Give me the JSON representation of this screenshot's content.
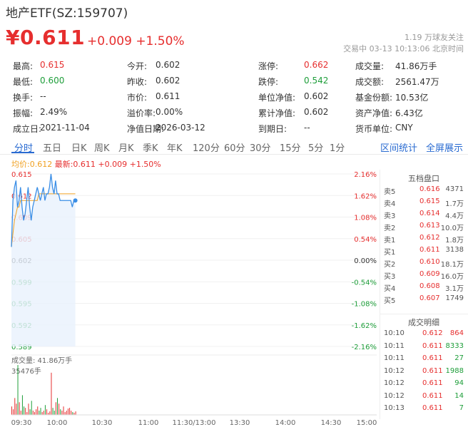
{
  "header": {
    "title": "地产ETF(SZ:159707)",
    "price": "¥0.611",
    "change": "+0.009  +1.50%",
    "followers": "1.19 万球友关注",
    "status": "交易中  03-13 10:13:06 北京时间"
  },
  "quote": [
    [
      {
        "l": "最高:",
        "v": "0.615",
        "c": "up"
      },
      {
        "l": "今开:",
        "v": "0.602",
        "c": ""
      },
      {
        "l": "涨停:",
        "v": "0.662",
        "c": "up"
      },
      {
        "l": "成交量:",
        "v": "41.86万手",
        "c": ""
      }
    ],
    [
      {
        "l": "最低:",
        "v": "0.600",
        "c": "down"
      },
      {
        "l": "昨收:",
        "v": "0.602",
        "c": ""
      },
      {
        "l": "跌停:",
        "v": "0.542",
        "c": "down"
      },
      {
        "l": "成交额:",
        "v": "2561.47万",
        "c": ""
      }
    ],
    [
      {
        "l": "换手:",
        "v": "--",
        "c": ""
      },
      {
        "l": "市价:",
        "v": "0.611",
        "c": ""
      },
      {
        "l": "单位净值:",
        "v": "0.602",
        "c": ""
      },
      {
        "l": "基金份额:",
        "v": "10.53亿",
        "c": ""
      }
    ],
    [
      {
        "l": "振幅:",
        "v": "2.49%",
        "c": ""
      },
      {
        "l": "溢价率:",
        "v": "0.00%",
        "c": ""
      },
      {
        "l": "累计净值:",
        "v": "0.602",
        "c": ""
      },
      {
        "l": "资产净值:",
        "v": "6.43亿",
        "c": ""
      }
    ],
    [
      {
        "l": "成立日:",
        "v": "2021-11-04",
        "c": ""
      },
      {
        "l": "净值日期:",
        "v": "2026-03-12",
        "c": ""
      },
      {
        "l": "到期日:",
        "v": "--",
        "c": ""
      },
      {
        "l": "货币单位:",
        "v": "CNY",
        "c": ""
      }
    ]
  ],
  "tabs": [
    "分时",
    "五日",
    "日K",
    "周K",
    "月K",
    "季K",
    "年K",
    "120分",
    "60分",
    "30分",
    "15分",
    "5分",
    "1分"
  ],
  "links": {
    "interval_stats": "区间统计",
    "fullscreen": "全屏展示"
  },
  "legend": {
    "avg": "均价:0.612",
    "last": "最新:0.611 +0.009 +1.50%"
  },
  "chart_data": {
    "type": "line",
    "y_left": [
      "0.615",
      "0.612",
      "0.609",
      "0.605",
      "0.602",
      "0.599",
      "0.595",
      "0.592",
      "0.589"
    ],
    "y_right": [
      "2.16%",
      "1.62%",
      "1.08%",
      "0.54%",
      "0.00%",
      "-0.54%",
      "-1.08%",
      "-1.62%",
      "-2.16%"
    ],
    "ylim": [
      0.589,
      0.615
    ],
    "x_ticks": [
      "09:30",
      "10:00",
      "10:30",
      "11:00",
      "11:30/13:00",
      "13:30",
      "14:00",
      "14:30",
      "15:00"
    ],
    "price": [
      0.604,
      0.611,
      0.613,
      0.614,
      0.61,
      0.611,
      0.613,
      0.61,
      0.608,
      0.609,
      0.611,
      0.613,
      0.61,
      0.608,
      0.61,
      0.611,
      0.612,
      0.613,
      0.612,
      0.611,
      0.612,
      0.613,
      0.611,
      0.612,
      0.612,
      0.613,
      0.615,
      0.613,
      0.612,
      0.614,
      0.612,
      0.612,
      0.611,
      0.611,
      0.611,
      0.611,
      0.611,
      0.611,
      0.611,
      0.611,
      0.61,
      0.611,
      0.611
    ],
    "avg": [
      0.604,
      0.606,
      0.608,
      0.609,
      0.61,
      0.61,
      0.611,
      0.611,
      0.611,
      0.611,
      0.611,
      0.611,
      0.611,
      0.611,
      0.611,
      0.611,
      0.611,
      0.611,
      0.612,
      0.612,
      0.612,
      0.612,
      0.612,
      0.612,
      0.612,
      0.612,
      0.612,
      0.612,
      0.612,
      0.612,
      0.612,
      0.612,
      0.612,
      0.612,
      0.612,
      0.612,
      0.612,
      0.612,
      0.612,
      0.612,
      0.612,
      0.612,
      0.612
    ],
    "volume_label": "成交量: 41.86万手",
    "volume_max_label": "35476手",
    "volume_max": 35476,
    "volume": [
      6000,
      4000,
      12000,
      8000,
      35476,
      9000,
      3000,
      14000,
      6000,
      5000,
      2000,
      8000,
      4000,
      10000,
      3000,
      2000,
      4000,
      6000,
      3000,
      5000,
      2000,
      3000,
      7000,
      4000,
      1500,
      2500,
      30000,
      5000,
      3000,
      9000,
      12000,
      8000,
      4000,
      3000,
      6000,
      2000,
      3000,
      4500,
      5000,
      3000,
      2000,
      1500,
      2500
    ]
  },
  "orderbook": {
    "title": "五档盘口",
    "asks": [
      {
        "name": "卖5",
        "price": "0.616",
        "vol": "4371"
      },
      {
        "name": "卖4",
        "price": "0.615",
        "vol": "1.7万"
      },
      {
        "name": "卖3",
        "price": "0.614",
        "vol": "4.4万"
      },
      {
        "name": "卖2",
        "price": "0.613",
        "vol": "10.0万"
      },
      {
        "name": "卖1",
        "price": "0.612",
        "vol": "1.8万"
      }
    ],
    "bids": [
      {
        "name": "买1",
        "price": "0.611",
        "vol": "3138"
      },
      {
        "name": "买2",
        "price": "0.610",
        "vol": "18.1万"
      },
      {
        "name": "买3",
        "price": "0.609",
        "vol": "16.0万"
      },
      {
        "name": "买4",
        "price": "0.608",
        "vol": "3.1万"
      },
      {
        "name": "买5",
        "price": "0.607",
        "vol": "1749"
      }
    ]
  },
  "trades": {
    "title": "成交明细",
    "rows": [
      {
        "t": "10:10",
        "p": "0.612",
        "v": "864"
      },
      {
        "t": "10:11",
        "p": "0.611",
        "v": "8333"
      },
      {
        "t": "10:11",
        "p": "0.611",
        "v": "27"
      },
      {
        "t": "10:12",
        "p": "0.611",
        "v": "1988"
      },
      {
        "t": "10:12",
        "p": "0.611",
        "v": "94"
      },
      {
        "t": "10:12",
        "p": "0.611",
        "v": "14"
      },
      {
        "t": "10:13",
        "p": "0.611",
        "v": "7"
      }
    ]
  },
  "colors": {
    "up": "#e62e2e",
    "down": "#1e9e3a",
    "line": "#3a8ee6",
    "avg": "#f0a020",
    "accent": "#2a6bd1"
  }
}
